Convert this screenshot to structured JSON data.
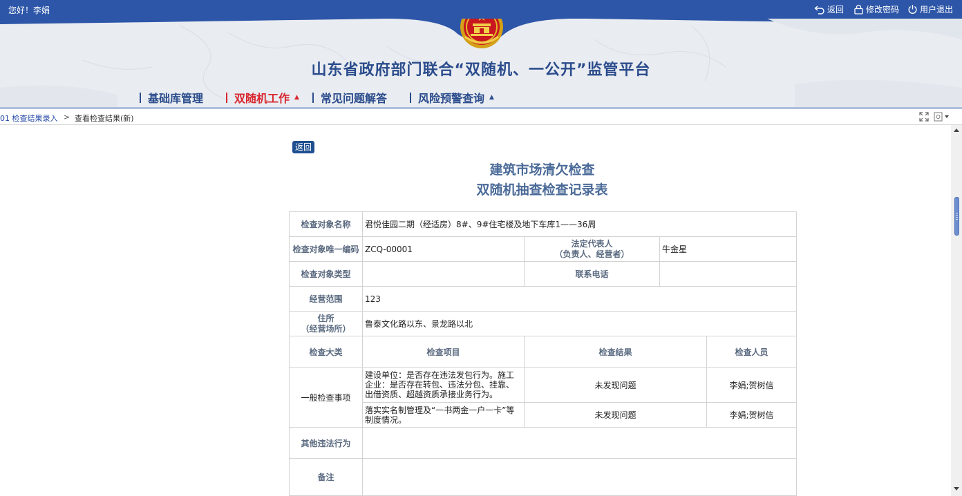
{
  "topbar": {
    "greeting": "您好！李娟",
    "back_label": "返回",
    "change_password_label": "修改密码",
    "logout_label": "用户退出"
  },
  "header": {
    "site_title": "山东省政府部门联合“双随机、一公开”监管平台"
  },
  "nav": {
    "items": [
      {
        "label": "基础库管理",
        "active": false
      },
      {
        "label": "双随机工作",
        "active": true,
        "caret": "▲"
      },
      {
        "label": "常见问题解答",
        "active": false
      },
      {
        "label": "风险预警查询",
        "active": false,
        "caret": "▲"
      }
    ]
  },
  "breadcrumb": {
    "item1": "01 检查结果录入",
    "separator": ">",
    "item2": "查看检查结果(新)"
  },
  "content": {
    "back_button": "返回",
    "title_line1": "建筑市场清欠检查",
    "title_line2": "双随机抽查检查记录表"
  },
  "form": {
    "object_name_label": "检查对象名称",
    "object_name_value": "君悦佳园二期（经适房）8#、9#住宅楼及地下车库1——36周",
    "object_code_label": "检查对象唯一编码",
    "object_code_value": "ZCQ-00001",
    "legal_rep_label_1": "法定代表人",
    "legal_rep_label_2": "（负责人、经营者）",
    "legal_rep_value": "牛金星",
    "object_type_label": "检查对象类型",
    "object_type_value": "",
    "phone_label": "联系电话",
    "phone_value": "",
    "scope_label": "经营范围",
    "scope_value": "123",
    "address_label_1": "住所",
    "address_label_2": "（经营场所）",
    "address_value": "鲁泰文化路以东、景龙路以北",
    "col_category": "检查大类",
    "col_item": "检查项目",
    "col_result": "检查结果",
    "col_inspector": "检查人员",
    "category_value": "一般检查事项",
    "items": [
      {
        "item": "建设单位：是否存在违法发包行为。施工企业：是否存在转包、违法分包、挂靠、出借资质、超越资质承接业务行为。",
        "result": "未发现问题",
        "inspector": "李娟;贺树信"
      },
      {
        "item": "落实实名制管理及“一书两金一户一卡”等制度情况。",
        "result": "未发现问题",
        "inspector": "李娟;贺树信"
      }
    ],
    "other_violation_label": "其他违法行为",
    "other_violation_value": "",
    "remark_label": "备注",
    "remark_value": ""
  },
  "colors": {
    "topbar_bg": "#2d56a8",
    "title_blue": "#2b4c8c",
    "nav_active": "#d8262e",
    "back_button_bg": "#1f4f8f",
    "form_title": "#4a6a98",
    "label_text": "#5a6a80"
  },
  "icons": [
    "return-icon",
    "lock-icon",
    "power-icon",
    "national-emblem",
    "fullscreen-icon",
    "page-menu-icon"
  ]
}
